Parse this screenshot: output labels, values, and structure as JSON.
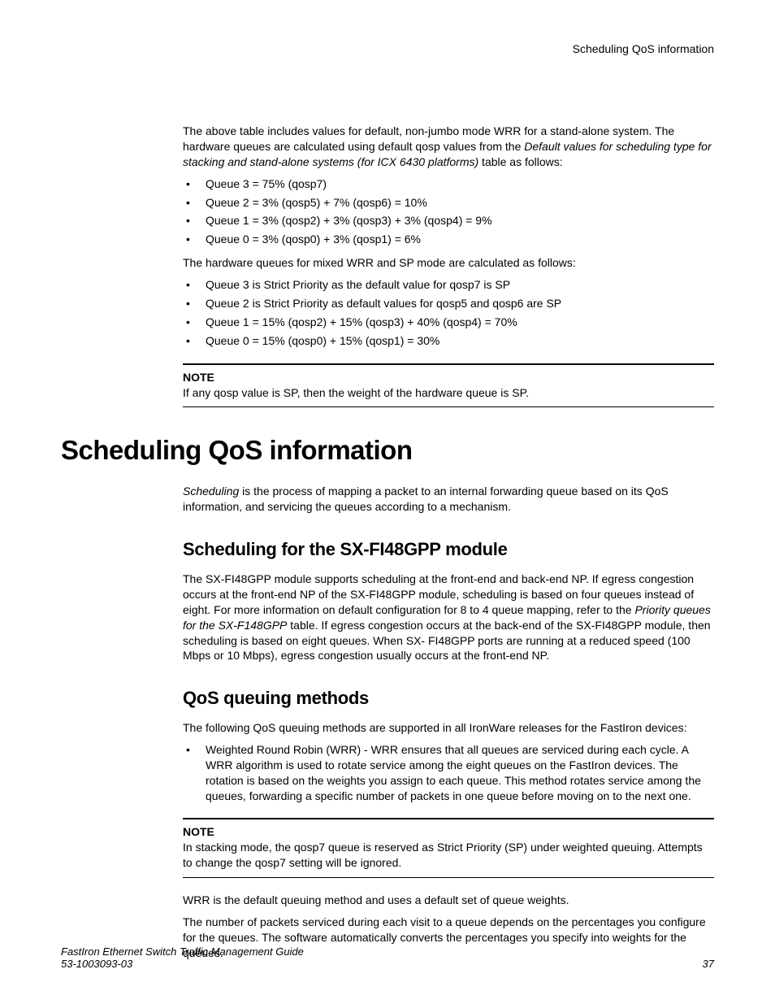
{
  "header": {
    "running_title": "Scheduling QoS information"
  },
  "intro": {
    "p1a": "The above table includes values for default, non-jumbo mode WRR for a stand-alone system. The hardware queues are calculated using default qosp values from the ",
    "p1b_italic": "Default values for scheduling type for stacking and stand-alone systems (for ICX 6430 platforms)",
    "p1c": " table as follows:"
  },
  "list1": [
    "Queue 3 = 75% (qosp7)",
    "Queue 2 = 3% (qosp5) + 7% (qosp6) = 10%",
    "Queue 1 = 3% (qosp2) + 3% (qosp3) + 3% (qosp4) = 9%",
    "Queue 0 = 3% (qosp0) + 3% (qosp1) = 6%"
  ],
  "intro2": "The hardware queues for mixed WRR and SP mode are calculated as follows:",
  "list2": [
    "Queue 3 is Strict Priority as the default value for qosp7 is SP",
    "Queue 2 is Strict Priority as default values for qosp5 and qosp6 are SP",
    "Queue 1 = 15% (qosp2) + 15% (qosp3) + 40% (qosp4) = 70%",
    "Queue 0 = 15% (qosp0) + 15% (qosp1) = 30%"
  ],
  "note1": {
    "label": "NOTE",
    "text": "If any qosp value is SP, then the weight of the hardware queue is SP."
  },
  "h1": "Scheduling QoS information",
  "sched_para": {
    "italic": "Scheduling",
    "rest": " is the process of mapping a packet to an internal forwarding queue based on its QoS information, and servicing the queues according to a mechanism."
  },
  "h2a": "Scheduling for the SX-FI48GPP module",
  "sx_para": {
    "a": "The SX-FI48GPP module supports scheduling at the front-end and back-end NP. If egress congestion occurs at the front-end NP of the SX-FI48GPP module, scheduling is based on four queues instead of eight. For more information on default configuration for 8 to 4 queue mapping, refer to the ",
    "b_italic": "Priority queues for the SX-F148GPP",
    "c": " table. If egress congestion occurs at the back-end of the SX-FI48GPP module, then scheduling is based on eight queues. When SX- FI48GPP ports are running at a reduced speed (100 Mbps or 10 Mbps), egress congestion usually occurs at the front-end NP."
  },
  "h2b": "QoS queuing methods",
  "qos_intro": "The following QoS queuing methods are supported in all IronWare releases for the FastIron devices:",
  "qos_list": [
    "Weighted Round Robin (WRR) - WRR ensures that all queues are serviced during each cycle. A WRR algorithm is used to rotate service among the eight queues on the FastIron devices. The rotation is based on the weights you assign to each queue. This method rotates service among the queues, forwarding a specific number of packets in one queue before moving on to the next one."
  ],
  "note2": {
    "label": "NOTE",
    "text": "In stacking mode, the qosp7 queue is reserved as Strict Priority (SP) under weighted queuing. Attempts to change the qosp7 setting will be ignored."
  },
  "tail1": "WRR is the default queuing method and uses a default set of queue weights.",
  "tail2": "The number of packets serviced during each visit to a queue depends on the percentages you configure for the queues. The software automatically converts the percentages you specify into weights for the queues.",
  "footer": {
    "title": "FastIron Ethernet Switch Traffic Management Guide",
    "docnum": "53-1003093-03",
    "page": "37"
  }
}
